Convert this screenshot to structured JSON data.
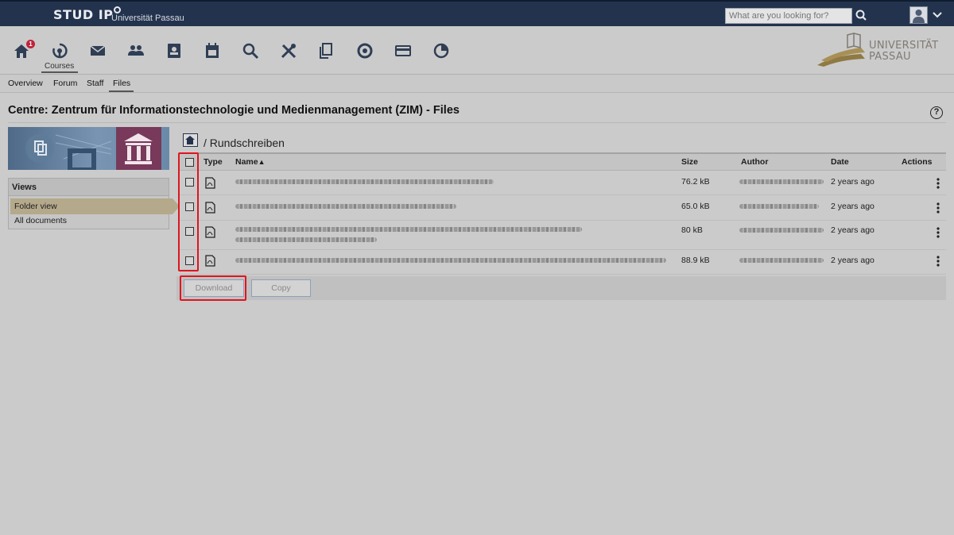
{
  "app": {
    "brand": "STUD IP",
    "university": "Universität Passau"
  },
  "search": {
    "placeholder": "What are you looking for?"
  },
  "nav": {
    "badge_count": "1",
    "courses_label": "Courses",
    "icons": [
      "home-icon",
      "courses-icon",
      "messages-icon",
      "community-icon",
      "profile-icon",
      "schedule-icon",
      "search-icon",
      "tools-icon",
      "files-icon",
      "help-icon",
      "payment-icon",
      "stats-icon"
    ]
  },
  "logo": {
    "line1": "UNIVERSITÄT",
    "line2": "PASSAU"
  },
  "subnav": {
    "items": [
      "Overview",
      "Forum",
      "Staff",
      "Files"
    ],
    "active": "Files"
  },
  "page": {
    "title": "Centre: Zentrum für Informationstechnologie und Medienmanagement (ZIM) - Files",
    "help": "?"
  },
  "sidebar": {
    "views_title": "Views",
    "items": [
      "Folder view",
      "All documents"
    ],
    "active": "Folder view"
  },
  "breadcrumb": {
    "separator": "/",
    "folder": "Rundschreiben"
  },
  "table": {
    "headers": {
      "type": "Type",
      "name": "Name",
      "sort_indicator": "▲",
      "size": "Size",
      "author": "Author",
      "date": "Date",
      "actions": "Actions"
    },
    "rows": [
      {
        "size": "76.2 kB",
        "date": "2 years ago"
      },
      {
        "size": "65.0 kB",
        "date": "2 years ago"
      },
      {
        "size": "80 kB",
        "date": "2 years ago"
      },
      {
        "size": "88.9 kB",
        "date": "2 years ago"
      }
    ]
  },
  "buttons": {
    "download": "Download",
    "copy": "Copy"
  },
  "colors": {
    "topbar": "#24334d",
    "highlight": "#e1141e",
    "overlay_bg": "#cbcbcb",
    "active_view": "#b5a98b"
  }
}
